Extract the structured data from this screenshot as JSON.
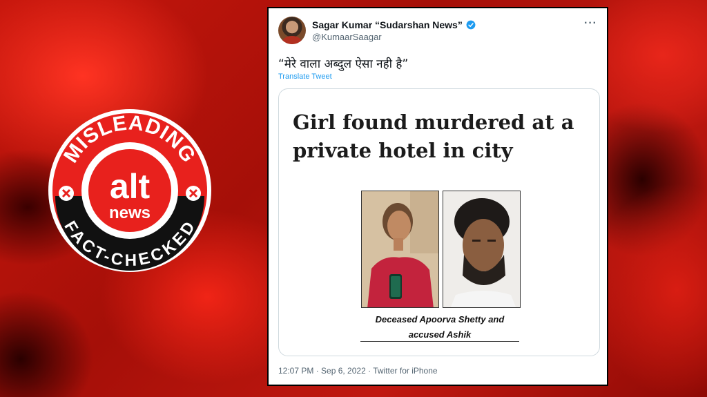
{
  "badge": {
    "top_text": "MISLEADING",
    "logo_top": "alt",
    "logo_bottom": "news",
    "bottom_text": "FACT-CHECKED"
  },
  "tweet": {
    "author_name": "Sagar Kumar “Sudarshan News”",
    "handle": "@KumaarSaagar",
    "more_label": "···",
    "text": "“मेरे वाला अब्दुल ऐसा नही है”",
    "translate_label": "Translate Tweet",
    "timestamp": "12:07 PM · Sep 6, 2022 · Twitter for iPhone"
  },
  "media": {
    "headline": "Girl found murdered at a private hotel in city",
    "caption_line1": "Deceased Apoorva Shetty and",
    "caption_line2": "accused Ashik"
  },
  "colors": {
    "badge_red": "#e8211d",
    "badge_black": "#111111",
    "verified_blue": "#1d9bf0",
    "link_blue": "#1d9bf0"
  },
  "icons": [
    "verified-badge-icon",
    "more-options-icon",
    "x-mark-icon"
  ]
}
